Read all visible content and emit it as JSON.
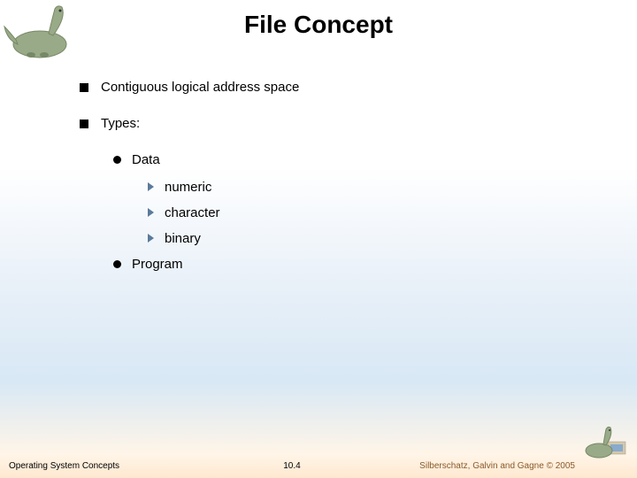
{
  "title": "File Concept",
  "bullets": {
    "b1": "Contiguous logical address space",
    "b2": "Types:",
    "b2_1": "Data",
    "b2_1_1": "numeric",
    "b2_1_2": "character",
    "b2_1_3": "binary",
    "b2_2": "Program"
  },
  "footer": {
    "left": "Operating System Concepts",
    "center": "10.4",
    "right": "Silberschatz, Galvin and Gagne © 2005"
  }
}
